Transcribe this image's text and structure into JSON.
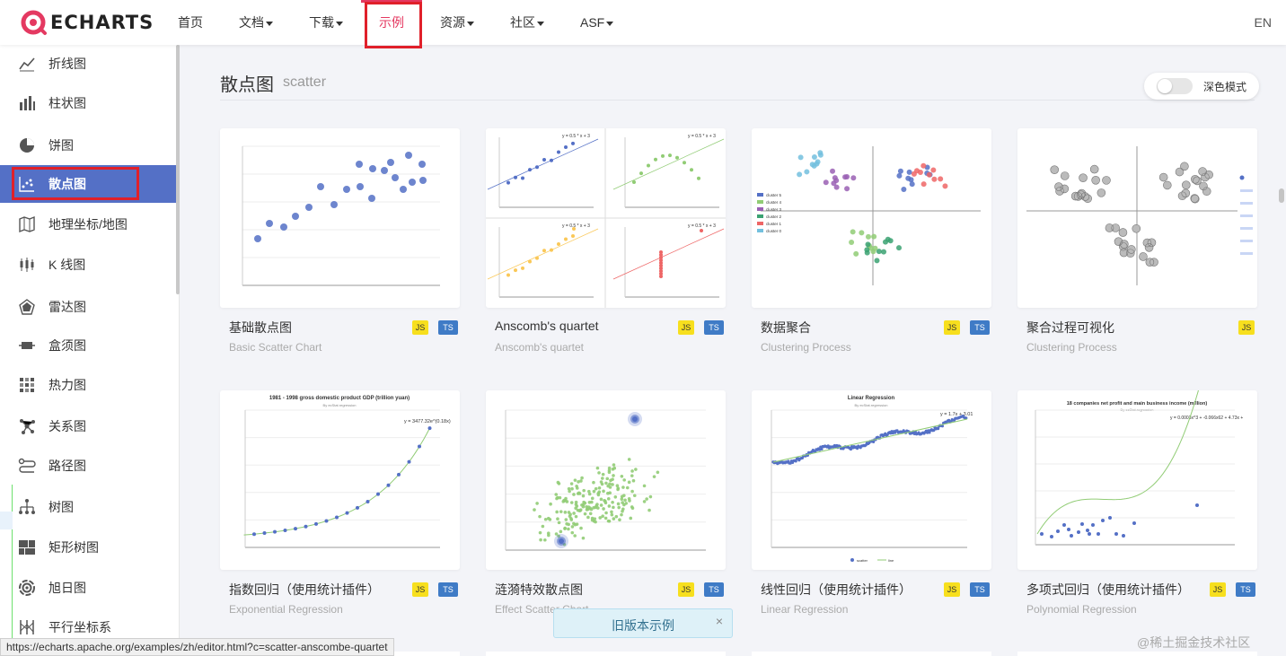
{
  "brand": {
    "name": "ECHARTS",
    "accent": "#e43961"
  },
  "nav": {
    "items": [
      {
        "label": "首页",
        "dropdown": false,
        "active": false
      },
      {
        "label": "文档",
        "dropdown": true,
        "active": false
      },
      {
        "label": "下载",
        "dropdown": true,
        "active": false
      },
      {
        "label": "示例",
        "dropdown": false,
        "active": true
      },
      {
        "label": "资源",
        "dropdown": true,
        "active": false
      },
      {
        "label": "社区",
        "dropdown": true,
        "active": false
      },
      {
        "label": "ASF",
        "dropdown": true,
        "active": false
      }
    ],
    "lang": "EN"
  },
  "sidebar": {
    "active_color": "#5470c6",
    "items": [
      {
        "label": "折线图",
        "icon": "line-chart-icon",
        "active": false
      },
      {
        "label": "柱状图",
        "icon": "bar-chart-icon",
        "active": false
      },
      {
        "label": "饼图",
        "icon": "pie-chart-icon",
        "active": false
      },
      {
        "label": "散点图",
        "icon": "scatter-chart-icon",
        "active": true
      },
      {
        "label": "地理坐标/地图",
        "icon": "map-icon",
        "active": false
      },
      {
        "label": "K 线图",
        "icon": "candlestick-icon",
        "active": false
      },
      {
        "label": "雷达图",
        "icon": "radar-icon",
        "active": false
      },
      {
        "label": "盒须图",
        "icon": "boxplot-icon",
        "active": false
      },
      {
        "label": "热力图",
        "icon": "heatmap-icon",
        "active": false
      },
      {
        "label": "关系图",
        "icon": "graph-icon",
        "active": false
      },
      {
        "label": "路径图",
        "icon": "lines-icon",
        "active": false
      },
      {
        "label": "树图",
        "icon": "tree-icon",
        "active": false
      },
      {
        "label": "矩形树图",
        "icon": "treemap-icon",
        "active": false
      },
      {
        "label": "旭日图",
        "icon": "sunburst-icon",
        "active": false
      },
      {
        "label": "平行坐标系",
        "icon": "parallel-icon",
        "active": false
      }
    ]
  },
  "main": {
    "title": "散点图",
    "subtitle": "scatter",
    "dark_mode_label": "深色模式",
    "dark_mode_on": false
  },
  "thumb_text": {
    "anscombe_eq": "y = 0.5 * x + 3",
    "cluster_legend": [
      "cluster 5",
      "cluster 4",
      "cluster 3",
      "cluster 2",
      "cluster 1",
      "cluster 0"
    ],
    "exp_title": "1981 - 1998 gross domestic product GDP (trillion yuan)",
    "exp_sub": "By ecStat.regression",
    "exp_eq": "y = 3477.32e^(0.18x)",
    "lin_title": "Linear Regression",
    "lin_sub": "By ecStat.regression",
    "lin_eq": "y = 1.7x + 3.01",
    "lin_legend": [
      "scatter",
      "line"
    ],
    "poly_title": "18 companies net profit and main business income (million)",
    "poly_sub": "By ecStat.regression",
    "poly_eq": "y = 0.0003x^3 + -0.066x62 + 4.73x +"
  },
  "cards": [
    {
      "title": "基础散点图",
      "subtitle": "Basic Scatter Chart",
      "js": true,
      "ts": true
    },
    {
      "title": "Anscomb's quartet",
      "subtitle": "Anscomb's quartet",
      "js": true,
      "ts": true
    },
    {
      "title": "数据聚合",
      "subtitle": "Clustering Process",
      "js": true,
      "ts": true
    },
    {
      "title": "聚合过程可视化",
      "subtitle": "Clustering Process",
      "js": true,
      "ts": false
    },
    {
      "title": "指数回归（使用统计插件）",
      "subtitle": "Exponential Regression",
      "js": true,
      "ts": true
    },
    {
      "title": "涟漪特效散点图",
      "subtitle": "Effect Scatter Chart",
      "js": true,
      "ts": true
    },
    {
      "title": "线性回归（使用统计插件）",
      "subtitle": "Linear Regression",
      "js": true,
      "ts": true
    },
    {
      "title": "多项式回归（使用统计插件）",
      "subtitle": "Polynomial Regression",
      "js": true,
      "ts": true
    }
  ],
  "badges": {
    "js": "JS",
    "ts": "TS"
  },
  "toast": {
    "text": "旧版本示例",
    "close": "×"
  },
  "status_url": "https://echarts.apache.org/examples/zh/editor.html?c=scatter-anscombe-quartet",
  "watermark": "@稀土掘金技术社区"
}
